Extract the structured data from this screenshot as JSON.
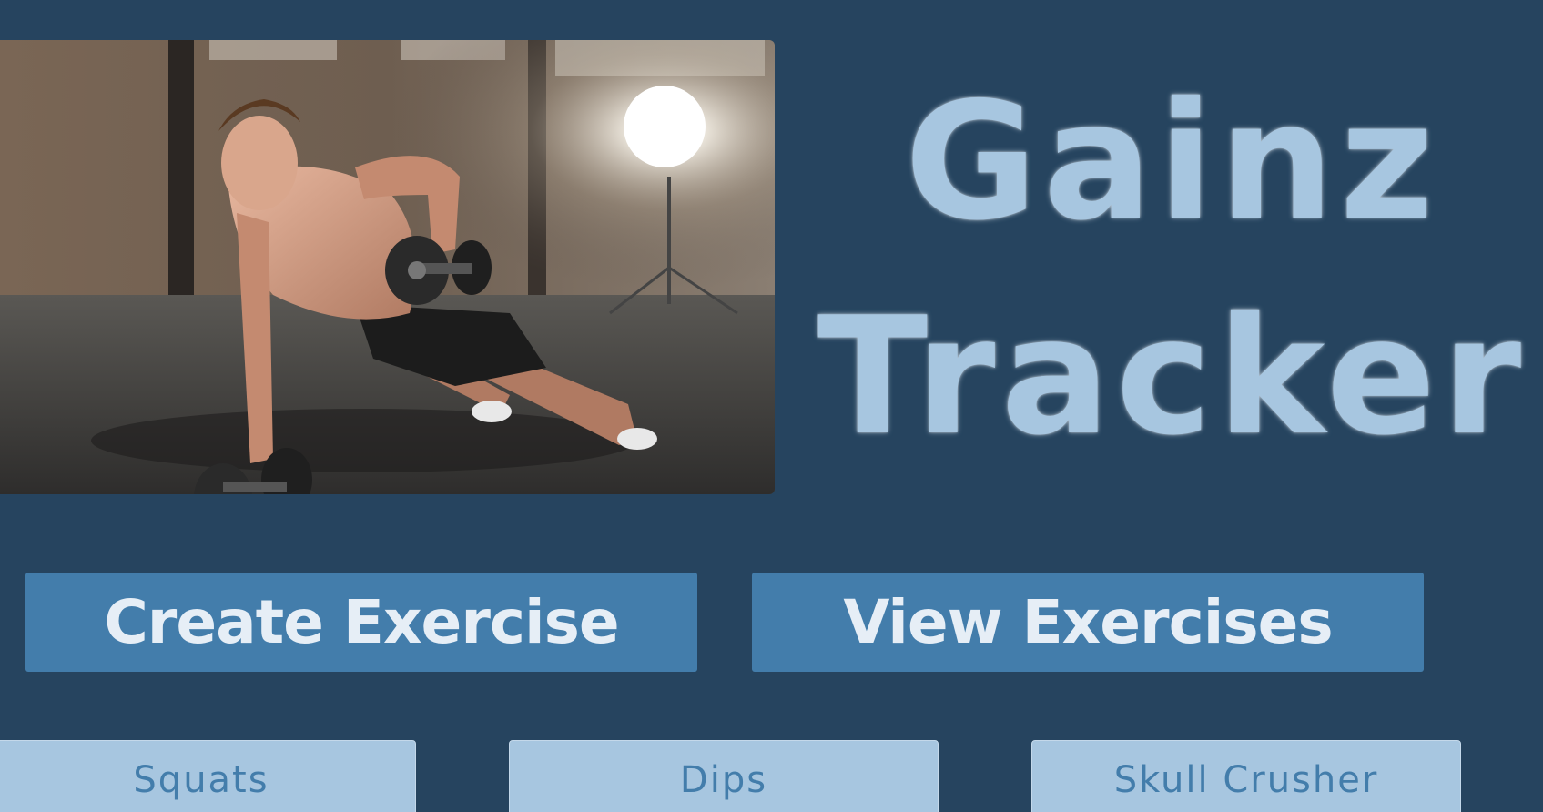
{
  "app": {
    "title_line1": "Gainz",
    "title_line2": "Tracker"
  },
  "hero": {
    "alt": "Man doing a dumbbell plank row in a warehouse"
  },
  "actions": {
    "create_label": "Create Exercise",
    "view_label": "View Exercises"
  },
  "exercises": [
    {
      "name": "Squats"
    },
    {
      "name": "Dips"
    },
    {
      "name": "Skull Crusher"
    }
  ],
  "colors": {
    "background": "#26445f",
    "accent": "#437dab",
    "title": "#a7c6e0",
    "card": "#a7c6e0",
    "button_text": "#e6eef6"
  }
}
